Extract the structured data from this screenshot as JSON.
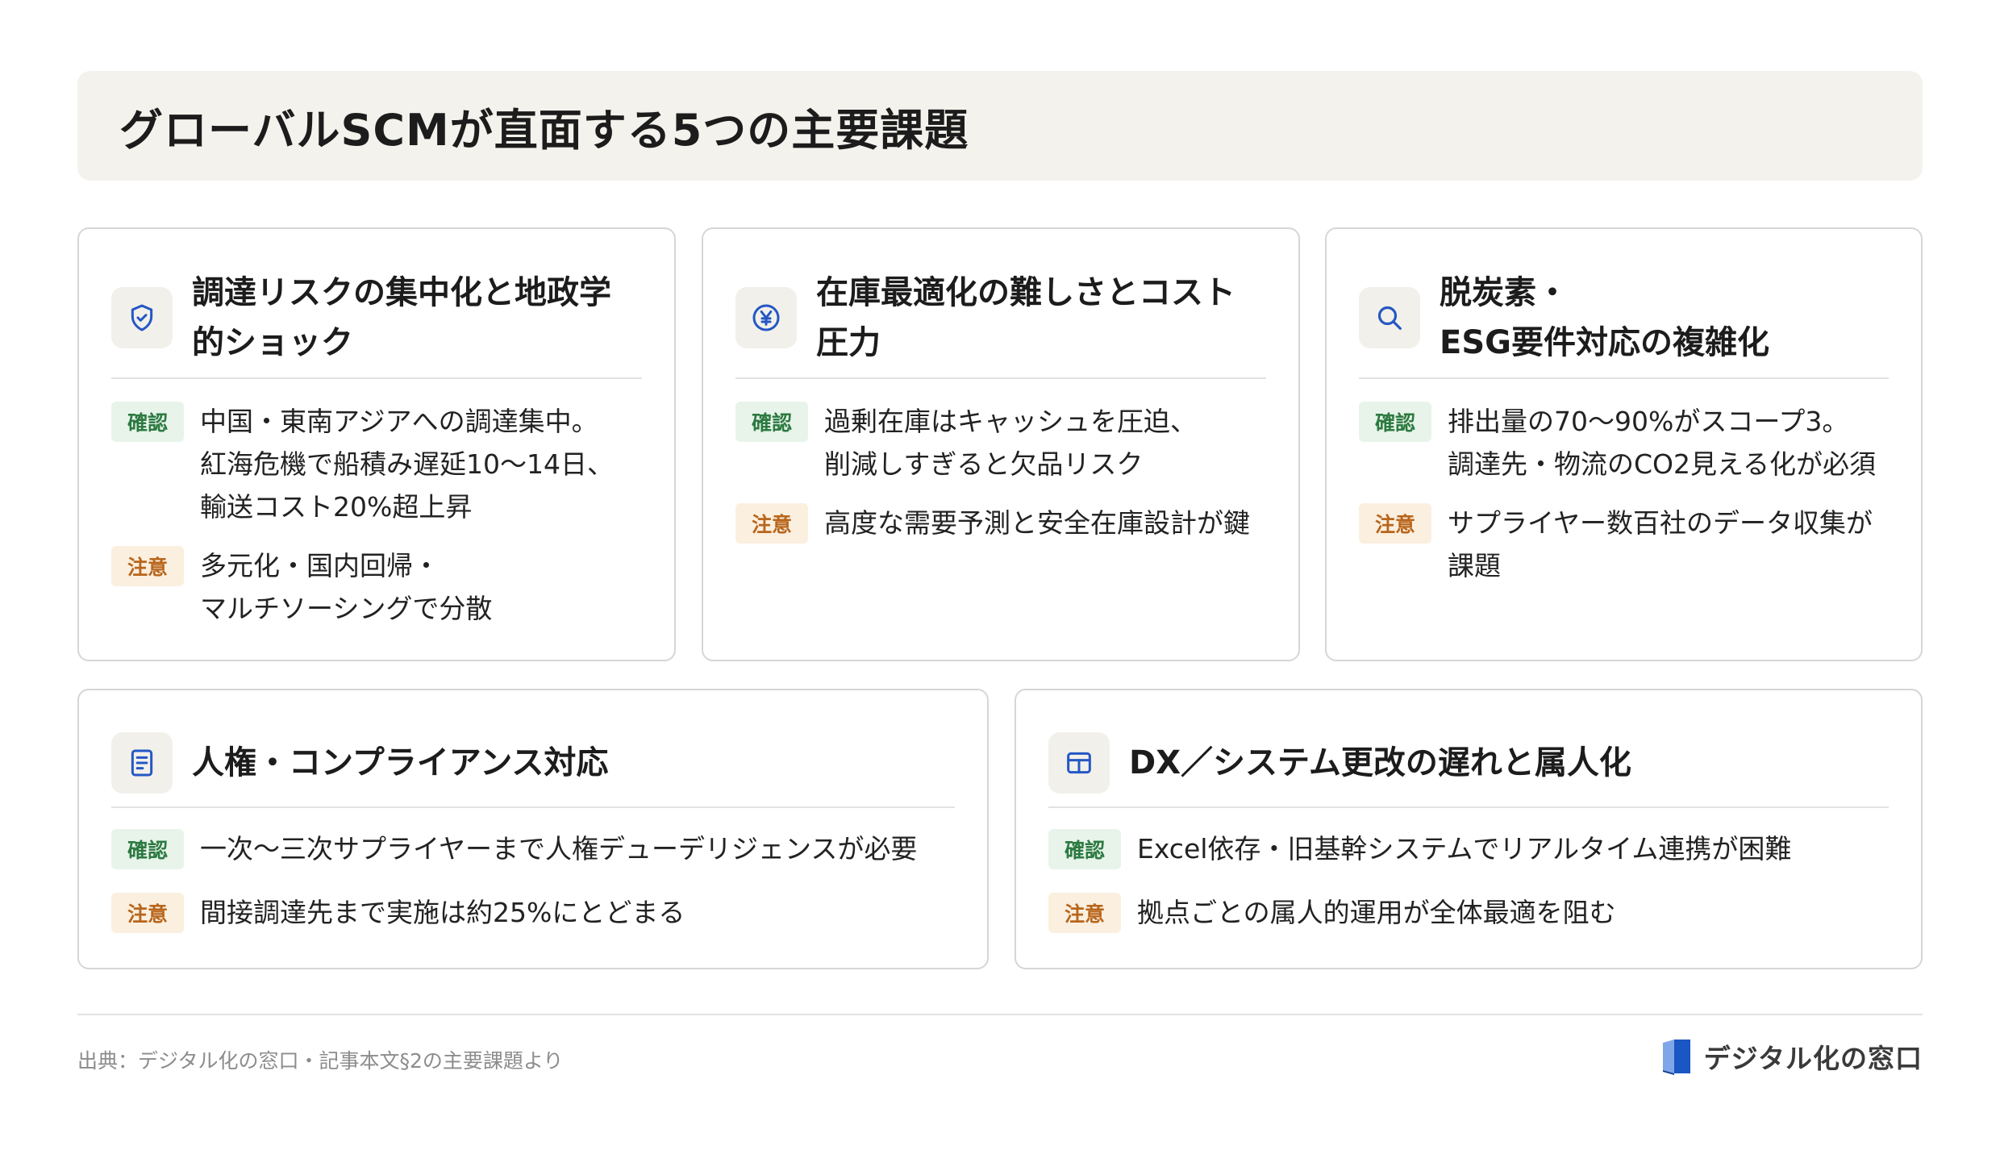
{
  "title": "グローバルSCMが直面する5つの主要課題",
  "colors": {
    "icon": "#2457c5",
    "confirm_badge_bg": "#e8f4ea",
    "confirm_badge_text": "#2c7a41",
    "caution_badge_bg": "#fbefdf",
    "caution_badge_text": "#b8661c",
    "banner_bg": "#f4f2ec",
    "brand_blue": "#1a56c4"
  },
  "badges": {
    "confirm": "確認",
    "caution": "注意"
  },
  "cards": [
    {
      "icon": "shield-check-icon",
      "title": "調達リスクの集中化と地政学\n的ショック",
      "confirm": "中国・東南アジアへの調達集中。\n紅海危機で船積み遅延10〜14日、\n輸送コスト20%超上昇",
      "caution": "多元化・国内回帰・\nマルチソーシングで分散"
    },
    {
      "icon": "yen-icon",
      "title": "在庫最適化の難しさとコスト\n圧力",
      "confirm": "過剰在庫はキャッシュを圧迫、\n削減しすぎると欠品リスク",
      "caution": "高度な需要予測と安全在庫設計が鍵"
    },
    {
      "icon": "search-icon",
      "title": "脱炭素・\nESG要件対応の複雑化",
      "confirm": "排出量の70〜90%がスコープ3。\n調達先・物流のCO2見える化が必須",
      "caution": "サプライヤー数百社のデータ収集が\n課題"
    },
    {
      "icon": "document-icon",
      "title": "人権・コンプライアンス対応",
      "confirm": "一次〜三次サプライヤーまで人権デューデリジェンスが必要",
      "caution": "間接調達先まで実施は約25%にとどまる"
    },
    {
      "icon": "grid-icon",
      "title": "DX／システム更改の遅れと属人化",
      "confirm": "Excel依存・旧基幹システムでリアルタイム連携が困難",
      "caution": "拠点ごとの属人的運用が全体最適を阻む"
    }
  ],
  "footer": {
    "source": "出典：デジタル化の窓口・記事本文§2の主要課題より",
    "brand": "デジタル化の窓口"
  }
}
